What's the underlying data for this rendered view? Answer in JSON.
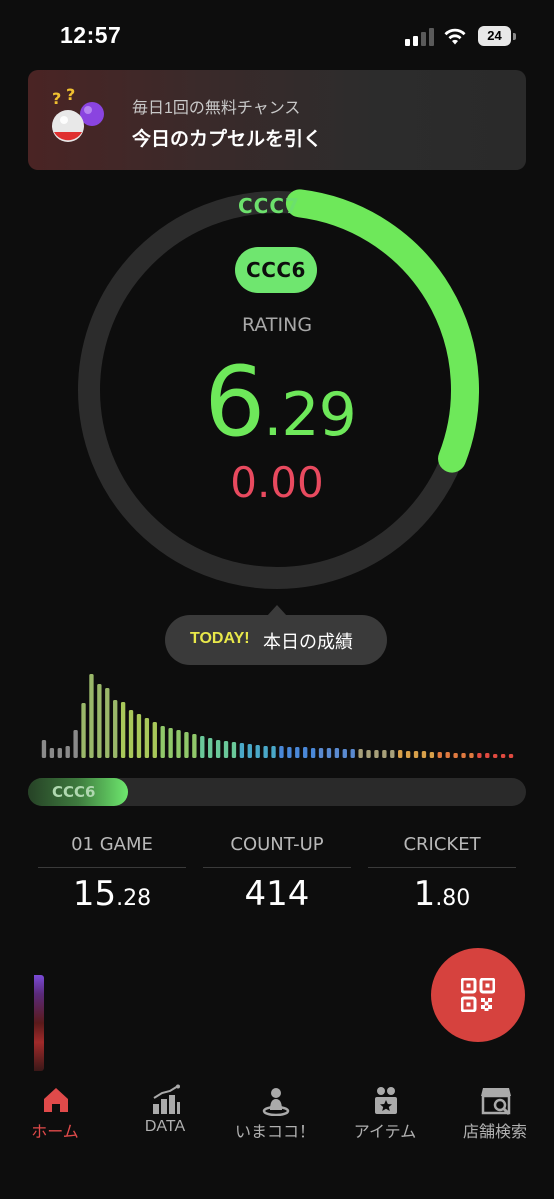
{
  "status_bar": {
    "time": "12:57",
    "battery": "24",
    "icons": [
      "cellular-signal-icon",
      "wifi-icon",
      "battery-icon"
    ]
  },
  "banner": {
    "subtitle": "毎日1回の無料チャンス",
    "title": "今日のカプセルを引く",
    "icon": "capsule-icon"
  },
  "rating": {
    "next_class": "CCC7",
    "current_class": "CCC6",
    "label": "RATING",
    "value_int": "6",
    "value_dec": ".29",
    "diff": "0.00",
    "gauge_progress": 0.29,
    "colors": {
      "accent": "#6ee85a",
      "diff": "#e84a5f",
      "track": "#2c2c2c"
    }
  },
  "today": {
    "tag": "TODAY!",
    "text": "本日の成績"
  },
  "progress": {
    "label": "CCC6",
    "fill": 0.2
  },
  "stats": [
    {
      "label": "01 GAME",
      "int": "15",
      "dec": ".28"
    },
    {
      "label": "COUNT-UP",
      "int": "414",
      "dec": ""
    },
    {
      "label": "CRICKET",
      "int": "1",
      "dec": ".80"
    }
  ],
  "qr_button": {
    "icon": "qr-code-icon",
    "color": "#d6423e"
  },
  "nav": {
    "items": [
      {
        "label": "ホーム",
        "icon": "home-icon",
        "active": true
      },
      {
        "label": "DATA",
        "icon": "chart-icon",
        "active": false
      },
      {
        "label": "いまココ！",
        "icon": "location-pin-icon",
        "active": false
      },
      {
        "label": "アイテム",
        "icon": "item-box-icon",
        "active": false
      },
      {
        "label": "店舗検索",
        "icon": "store-search-icon",
        "active": false
      }
    ],
    "active_color": "#e04a4a"
  }
}
